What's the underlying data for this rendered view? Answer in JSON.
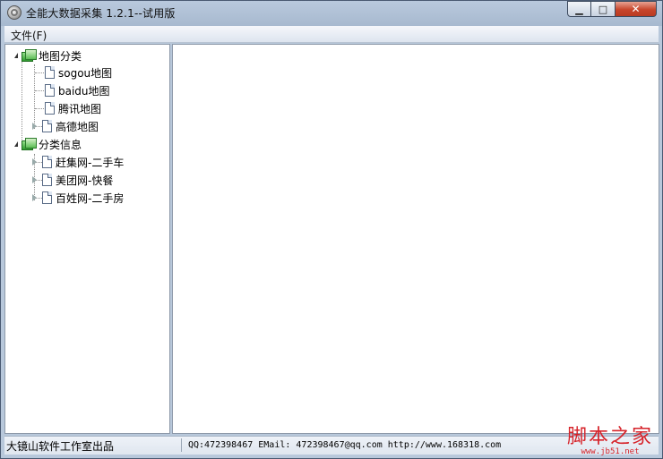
{
  "window": {
    "title": "全能大数据采集 1.2.1--试用版"
  },
  "window_controls": {
    "minimize": "▁",
    "maximize": "□",
    "close": "✕"
  },
  "menu": {
    "file": "文件(F)"
  },
  "tree": {
    "groups": [
      {
        "label": "地图分类",
        "expanded": true,
        "children": [
          "sogou地图",
          "baidu地图",
          "腾讯地图",
          "高德地图"
        ]
      },
      {
        "label": "分类信息",
        "expanded": true,
        "children": [
          "赶集网-二手车",
          "美团网-快餐",
          "百姓网-二手房"
        ]
      }
    ]
  },
  "status": {
    "company": "大镜山软件工作室出品",
    "contact": "QQ:472398467 EMail: 472398467@qq.com  http://www.168318.com"
  },
  "watermark": {
    "main": "脚本之家",
    "sub": "www.jb51.net"
  }
}
